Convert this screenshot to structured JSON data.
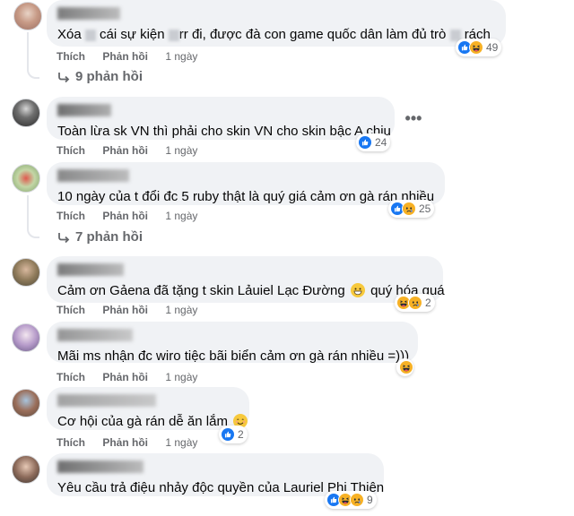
{
  "comments": [
    {
      "text": "Xóa  cái sự kiện  rr đi, được đà con game quốc dân làm đủ trò  rách",
      "text_parts": [
        "Xóa",
        "cái sự kiện",
        "rr đi, được đà con game quốc dân làm đủ trò",
        "rách"
      ],
      "like": "Thích",
      "reply": "Phản hồi",
      "time": "1 ngày",
      "reaction_count": "49",
      "reactions": [
        "like-icon",
        "haha-icon"
      ],
      "replies_label": "9 phản hồi"
    },
    {
      "text": "Toàn lừa sk VN thì phải cho skin VN cho skin bậc A chịu",
      "like": "Thích",
      "reply": "Phản hồi",
      "time": "1 ngày",
      "reaction_count": "24",
      "reactions": [
        "like-icon"
      ]
    },
    {
      "text": "10 ngày của t đổi đc 5 ruby thật là quý giá cảm ơn gà rán nhiều",
      "like": "Thích",
      "reply": "Phản hồi",
      "time": "1 ngày",
      "reaction_count": "25",
      "reactions": [
        "like-icon",
        "sad-icon"
      ],
      "replies_label": "7 phản hồi"
    },
    {
      "text": "Cảm ơn Gảena đã tặng t skin Lảuiel Lạc Đường",
      "emoji": "grin-emoji",
      "text_end": "quý hóa quá",
      "like": "Thích",
      "reply": "Phản hồi",
      "time": "1 ngày",
      "reaction_count": "2",
      "reactions": [
        "haha-icon",
        "sad-icon"
      ]
    },
    {
      "text": "Mãi ms nhận đc wiro tiệc bãi biển cảm ơn gà rán nhiều =)))",
      "like": "Thích",
      "reply": "Phản hồi",
      "time": "1 ngày",
      "reaction_count": "",
      "reactions": [
        "haha-icon"
      ]
    },
    {
      "text": "Cơ hội của gà rán dễ ăn lắm",
      "emoji": "smile-emoji",
      "like": "Thích",
      "reply": "Phản hồi",
      "time": "1 ngày",
      "reaction_count": "2",
      "reactions": [
        "like-icon"
      ]
    },
    {
      "text": "Yêu cầu trả điệu nhảy độc quyền của Lauriel Phi Thiên",
      "like": "Thích",
      "reply": "Phản hồi",
      "time": "1 ngày",
      "reaction_count": "9",
      "reactions": [
        "like-icon",
        "haha-icon",
        "sad-icon"
      ]
    }
  ],
  "more_options": "•••",
  "colors": {
    "bubble": "#f0f2f5",
    "secondary": "#65676b",
    "like_blue": "#1877f2",
    "emoji_yellow": "#f7b125"
  }
}
